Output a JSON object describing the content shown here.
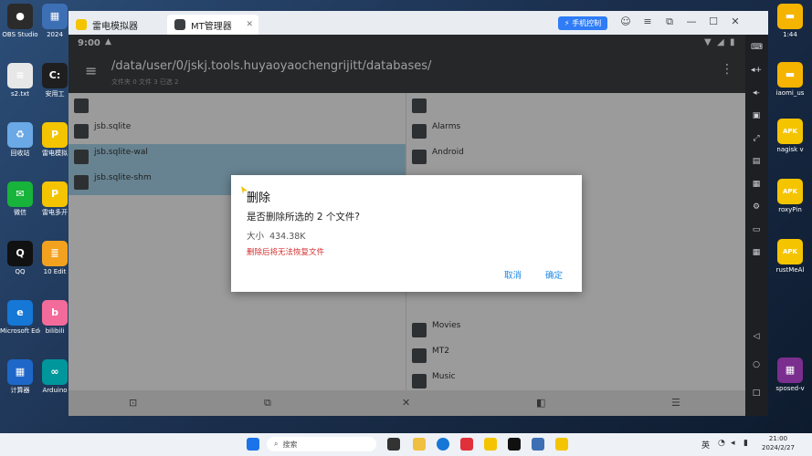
{
  "desktop": {
    "left_icons": [
      {
        "label": "OBS Studio",
        "color": "#2b2b2b",
        "glyph": "●"
      },
      {
        "label": "2024",
        "color": "#3d6fb5",
        "glyph": "▦"
      },
      {
        "label": "s2.txt",
        "color": "#e7e7e7",
        "glyph": "≡"
      },
      {
        "label": "安用工",
        "color": "#1f1f1f",
        "glyph": "C:"
      },
      {
        "label": "回收站",
        "color": "#6aa8e6",
        "glyph": "♻"
      },
      {
        "label": "雷电模拟",
        "color": "#f5c400",
        "glyph": "P"
      },
      {
        "label": "微信",
        "color": "#17b33a",
        "glyph": "✉"
      },
      {
        "label": "雷电多开",
        "color": "#f5c400",
        "glyph": "P"
      },
      {
        "label": "QQ",
        "color": "#111111",
        "glyph": "Q"
      },
      {
        "label": "10 Edit",
        "color": "#f3a21f",
        "glyph": "≣"
      },
      {
        "label": "Microsoft Edge",
        "color": "#1577d6",
        "glyph": "e"
      },
      {
        "label": "bilibili",
        "color": "#f36b9b",
        "glyph": "b"
      },
      {
        "label": "计算器",
        "color": "#1e67c8",
        "glyph": "▦"
      },
      {
        "label": "Arduino",
        "color": "#00979c",
        "glyph": "∞"
      }
    ],
    "right_icons": [
      {
        "label": "1:44",
        "color": "#f5b400",
        "glyph": "▬"
      },
      {
        "label": "iaomi_us",
        "color": "#f5b400",
        "glyph": "▬"
      },
      {
        "label": "nagisk v",
        "color": "#f5c400",
        "glyph": "APK"
      },
      {
        "label": "roxyPin",
        "color": "#f5c400",
        "glyph": "APK"
      },
      {
        "label": "rustMeAl",
        "color": "#f5c400",
        "glyph": "APK"
      },
      {
        "label": "sposed-v",
        "color": "#7a2e8e",
        "glyph": "▦"
      }
    ]
  },
  "emulator": {
    "tabs": [
      {
        "label": "雷电模拟器",
        "color": "#f5c400"
      },
      {
        "label": "MT管理器",
        "color": "#ffffff"
      }
    ],
    "phone_control_label": "手机控制",
    "status": {
      "time": "9:00"
    },
    "appbar": {
      "path": "/data/user/0/jskj.tools.huyaoyaochengrijitt/databases/",
      "subtitle": "文件夹 0  文件 3  已选 2"
    },
    "left_pane": [
      {
        "name": "",
        "sub": "",
        "selected": false
      },
      {
        "name": "jsb.sqlite",
        "sub": "",
        "selected": false
      },
      {
        "name": "jsb.sqlite-wal",
        "sub": "",
        "selected": true
      },
      {
        "name": "jsb.sqlite-shm",
        "sub": "",
        "selected": true
      }
    ],
    "right_pane": [
      {
        "name": "",
        "sub": ""
      },
      {
        "name": "Alarms",
        "sub": ""
      },
      {
        "name": "Android",
        "sub": ""
      },
      {
        "name": "Movies",
        "sub": ""
      },
      {
        "name": "MT2",
        "sub": ""
      },
      {
        "name": "Music",
        "sub": ""
      }
    ]
  },
  "dialog": {
    "title": "删除",
    "message": "是否删除所选的 2 个文件?",
    "size_label": "大小",
    "size_value": "434.38K",
    "warning": "删除后将无法恢复文件",
    "cancel_label": "取消",
    "ok_label": "确定"
  },
  "taskbar": {
    "search_label": "搜索",
    "lang": "英",
    "time": "21:00",
    "date": "2024/2/27"
  },
  "colors": {
    "accent": "#1e88e5",
    "warning": "#d32f2f",
    "selection": "#a6d4ea",
    "appbar": "#3c3f42"
  }
}
